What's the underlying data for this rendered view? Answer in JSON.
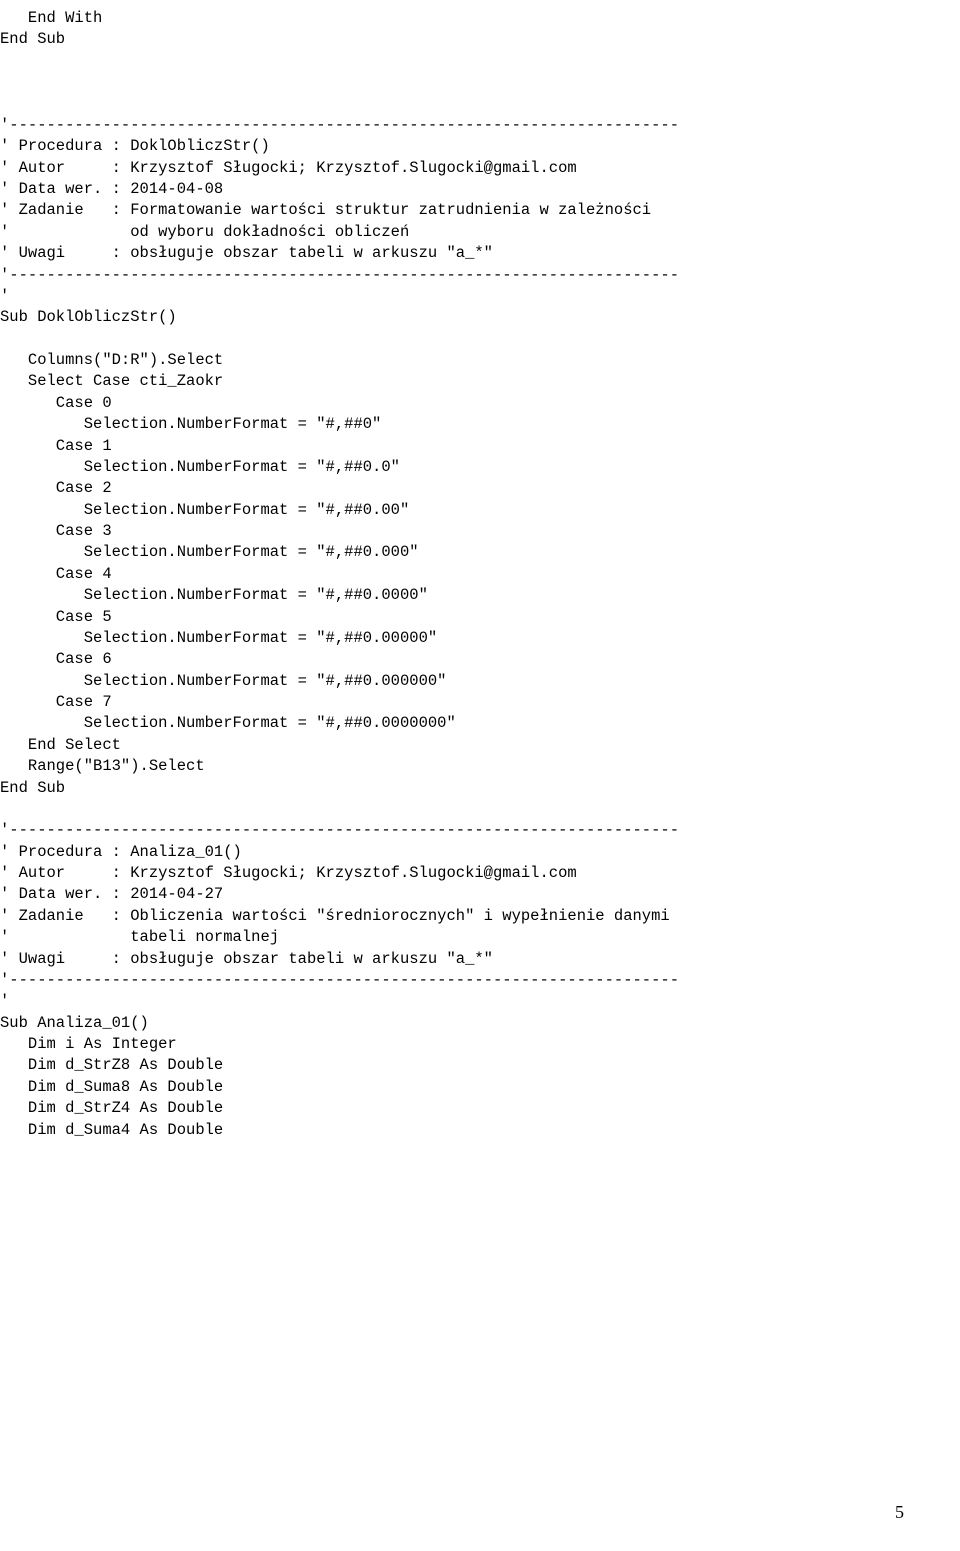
{
  "code_text": "   End With\nEnd Sub\n\n\n\n'------------------------------------------------------------------------\n' Procedura : DoklObliczStr()\n' Autor     : Krzysztof Sługocki; Krzysztof.Slugocki@gmail.com\n' Data wer. : 2014-04-08\n' Zadanie   : Formatowanie wartości struktur zatrudnienia w zależności\n'             od wyboru dokładności obliczeń\n' Uwagi     : obsługuje obszar tabeli w arkuszu \"a_*\"\n'------------------------------------------------------------------------\n'\nSub DoklObliczStr()\n\n   Columns(\"D:R\").Select\n   Select Case cti_Zaokr\n      Case 0\n         Selection.NumberFormat = \"#,##0\"\n      Case 1\n         Selection.NumberFormat = \"#,##0.0\"\n      Case 2\n         Selection.NumberFormat = \"#,##0.00\"\n      Case 3\n         Selection.NumberFormat = \"#,##0.000\"\n      Case 4\n         Selection.NumberFormat = \"#,##0.0000\"\n      Case 5\n         Selection.NumberFormat = \"#,##0.00000\"\n      Case 6\n         Selection.NumberFormat = \"#,##0.000000\"\n      Case 7\n         Selection.NumberFormat = \"#,##0.0000000\"\n   End Select\n   Range(\"B13\").Select\nEnd Sub\n\n'------------------------------------------------------------------------\n' Procedura : Analiza_01()\n' Autor     : Krzysztof Sługocki; Krzysztof.Slugocki@gmail.com\n' Data wer. : 2014-04-27\n' Zadanie   : Obliczenia wartości \"średniorocznych\" i wypełnienie danymi\n'             tabeli normalnej\n' Uwagi     : obsługuje obszar tabeli w arkuszu \"a_*\"\n'------------------------------------------------------------------------\n'\nSub Analiza_01()\n   Dim i As Integer\n   Dim d_StrZ8 As Double\n   Dim d_Suma8 As Double\n   Dim d_StrZ4 As Double\n   Dim d_Suma4 As Double",
  "page_number": "5"
}
